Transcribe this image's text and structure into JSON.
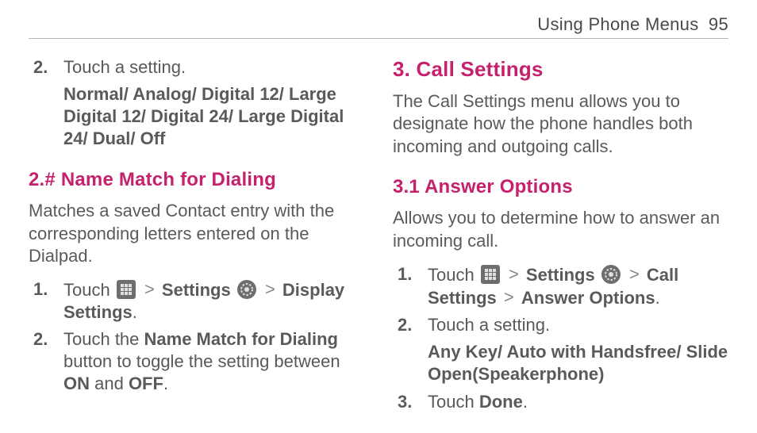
{
  "header": {
    "title": "Using Phone Menus",
    "page_number": "95"
  },
  "left": {
    "step_2": {
      "marker": "2.",
      "line": "Touch a setting.",
      "options": "Normal/ Analog/ Digital 12/ Large Digital 12/ Digital 24/ Large Digital 24/ Dual/ Off"
    },
    "heading": "2.# Name Match for Dialing",
    "para1": "Matches a saved Contact entry with the corresponding letters entered on the Dialpad.",
    "nm_step1": {
      "marker": "1.",
      "pre_touch": "Touch ",
      "sep": " > ",
      "settings": "Settings",
      "display_settings": "Display Settings",
      "period": "."
    },
    "nm_step2": {
      "marker": "2.",
      "pre": "Touch the ",
      "bold1": "Name Match for Dialing",
      "mid": " button to toggle the setting between ",
      "on": "ON",
      "and": " and ",
      "off": "OFF",
      "period": "."
    }
  },
  "right": {
    "heading": "3. Call Settings",
    "para1": "The Call Settings menu allows you to designate how the phone handles both incoming and outgoing calls.",
    "sub_heading": "3.1 Answer Options",
    "para2": "Allows you to determine how to answer an incoming call.",
    "step1": {
      "marker": "1.",
      "pre_touch": "Touch ",
      "sep": " > ",
      "settings": "Settings",
      "call_settings": "Call Settings",
      "answer_options": "Answer Options",
      "period": "."
    },
    "step2": {
      "marker": "2.",
      "line": "Touch a setting.",
      "options": "Any Key/ Auto with Handsfree/ Slide Open(Speakerphone)"
    },
    "step3": {
      "marker": "3.",
      "pre": "Touch ",
      "done": "Done",
      "period": "."
    }
  }
}
